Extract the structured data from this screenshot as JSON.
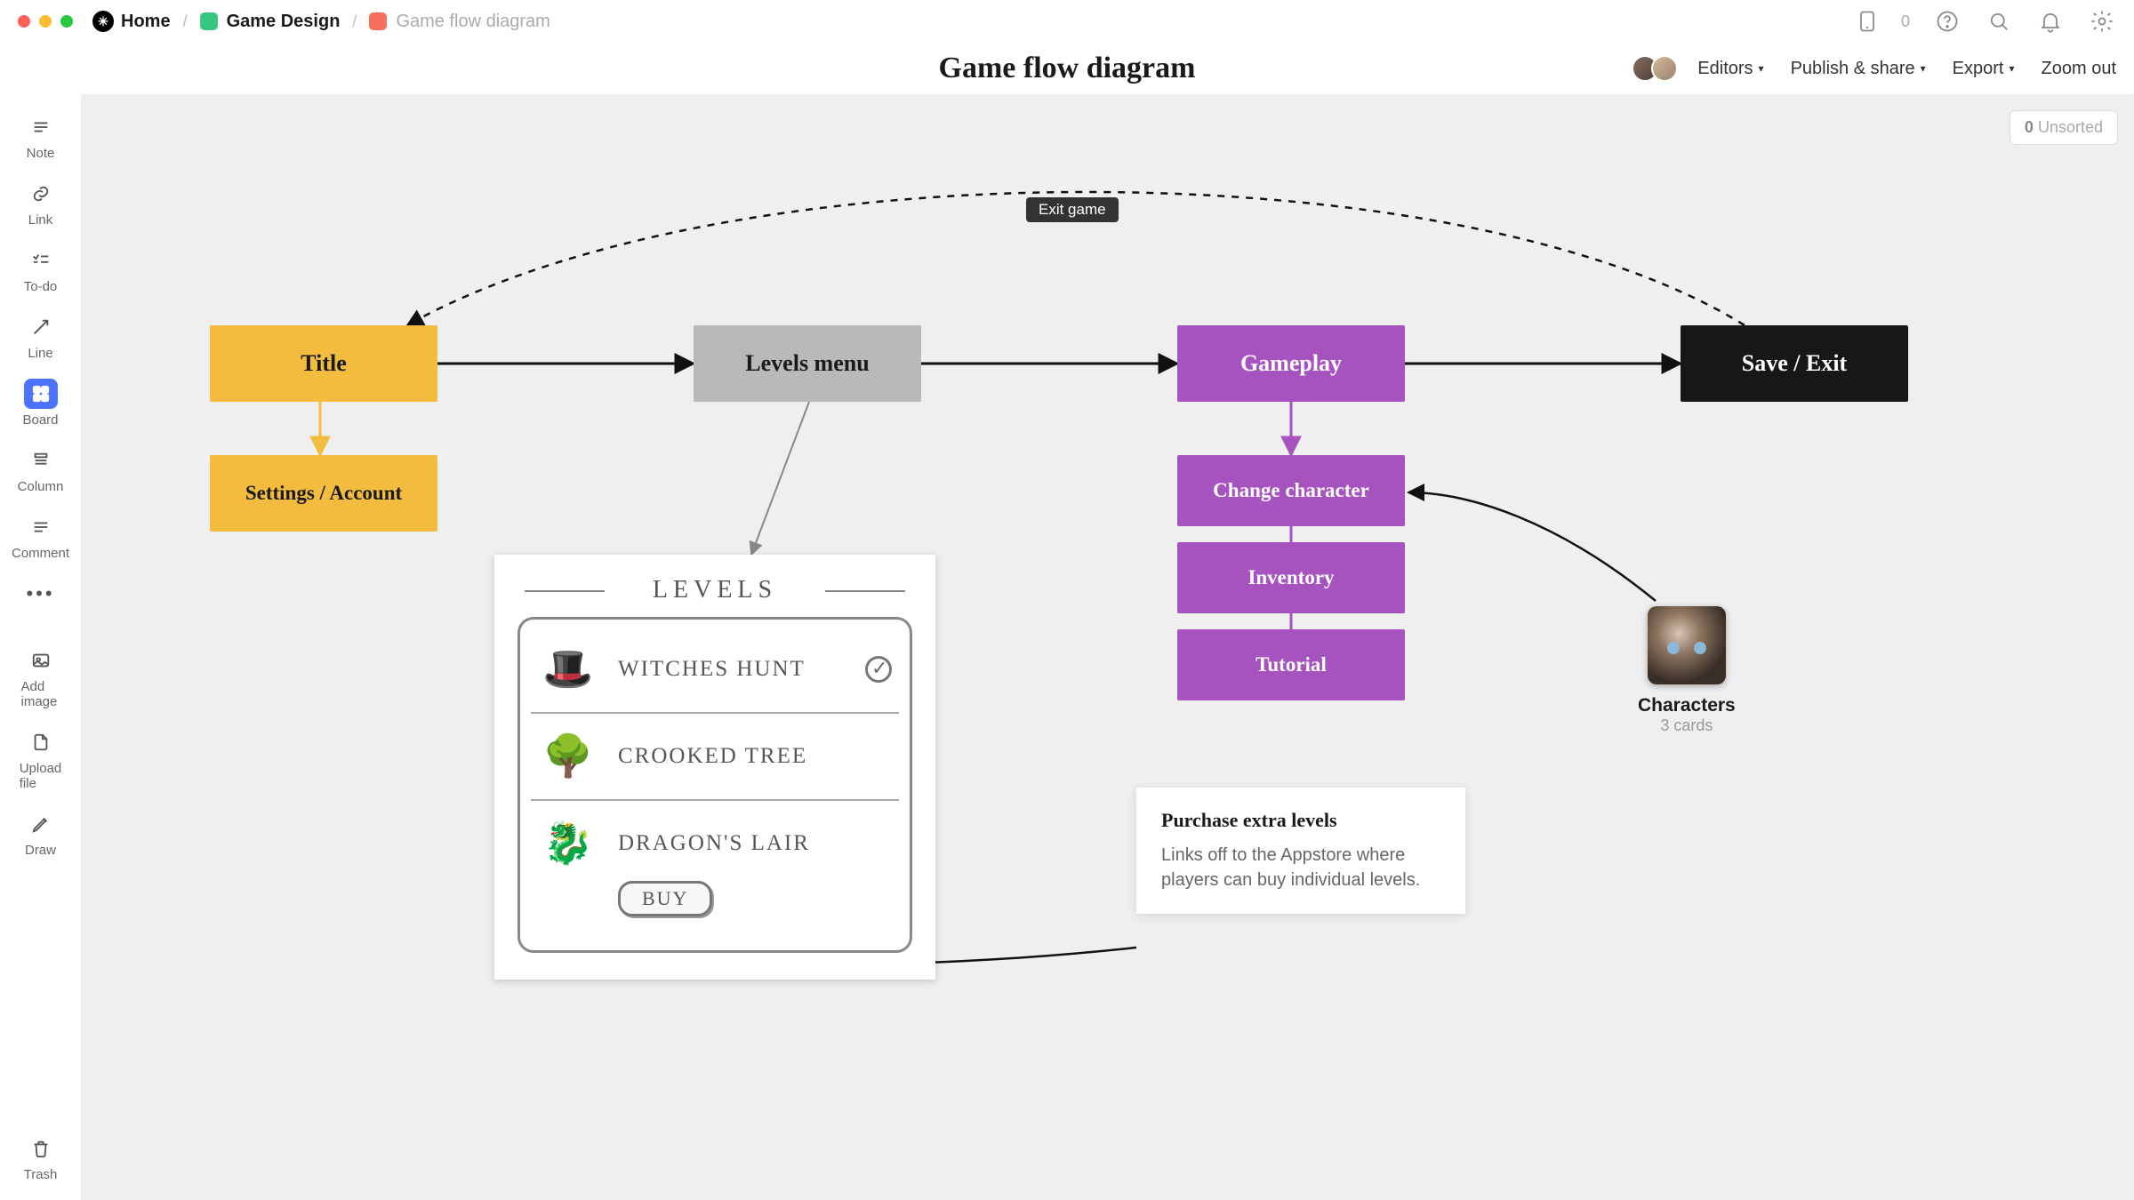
{
  "breadcrumb": {
    "home": "Home",
    "folder": "Game Design",
    "page": "Game flow diagram"
  },
  "tablet_count": "0",
  "page_title": "Game flow diagram",
  "subheader": {
    "editors": "Editors",
    "publish": "Publish & share",
    "export": "Export",
    "zoom_out": "Zoom out"
  },
  "sidebar": {
    "note": "Note",
    "link": "Link",
    "todo": "To-do",
    "line": "Line",
    "board": "Board",
    "column": "Column",
    "comment": "Comment",
    "addimage": "Add image",
    "upload": "Upload file",
    "draw": "Draw",
    "trash": "Trash"
  },
  "unsorted": {
    "count": "0",
    "label": "Unsorted"
  },
  "flow": {
    "title": "Title",
    "settings": "Settings / Account",
    "levels_menu": "Levels menu",
    "gameplay": "Gameplay",
    "change_character": "Change character",
    "inventory": "Inventory",
    "tutorial": "Tutorial",
    "save_exit": "Save / Exit",
    "edge_exit": "Exit game"
  },
  "sketch": {
    "heading": "LEVELS",
    "rows": [
      {
        "label": "WITCHES HUNT",
        "checked": true
      },
      {
        "label": "CROOKED TREE",
        "checked": false
      },
      {
        "label": "DRAGON'S LAIR",
        "checked": false,
        "buy": true
      }
    ],
    "buy_label": "BUY"
  },
  "note": {
    "title": "Purchase extra levels",
    "body": "Links off to the Appstore where players can buy individual levels."
  },
  "characters": {
    "title": "Characters",
    "sub": "3 cards"
  }
}
